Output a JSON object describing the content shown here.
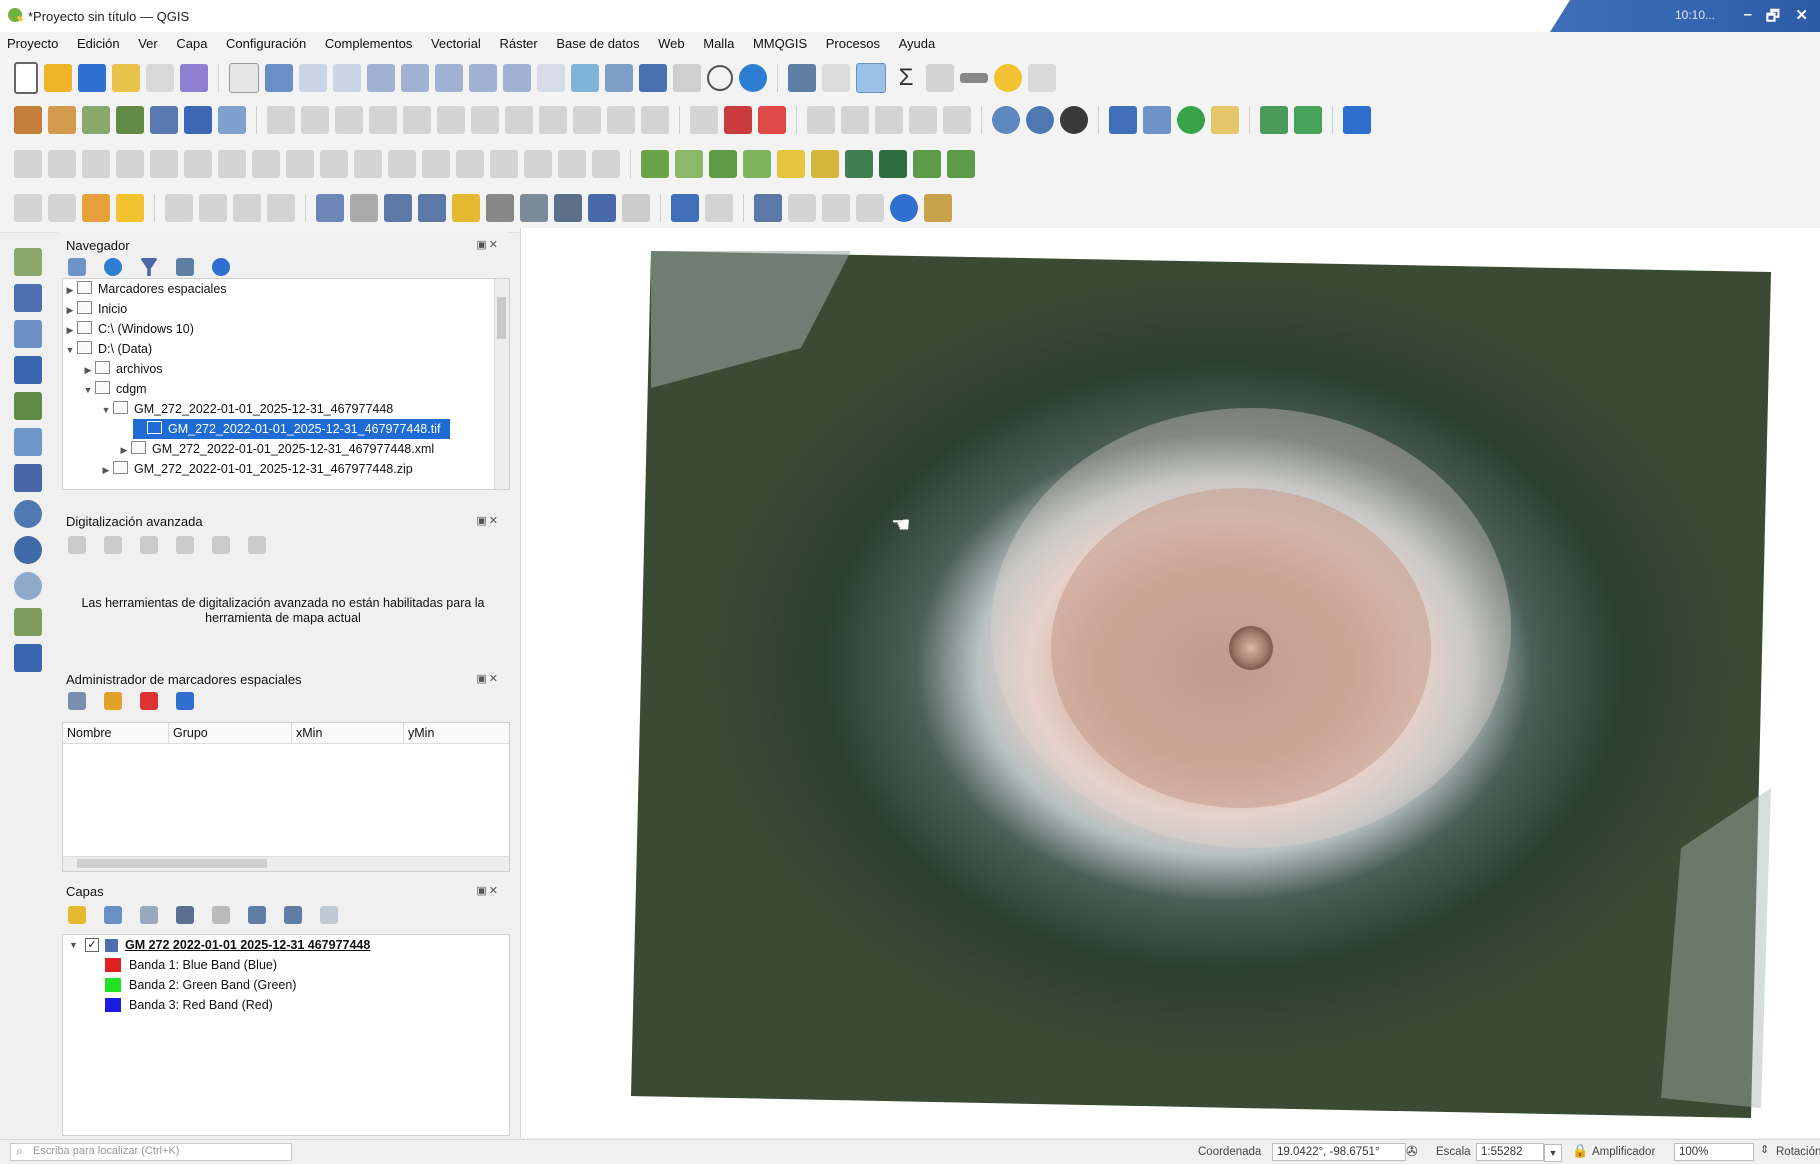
{
  "window": {
    "title": "*Proyecto sin título — QGIS",
    "clock": "10:10...",
    "controls": [
      "–",
      "🗗",
      "✕"
    ]
  },
  "menu": [
    "Proyecto",
    "Edición",
    "Ver",
    "Capa",
    "Configuración",
    "Complementos",
    "Vectorial",
    "Ráster",
    "Base de datos",
    "Web",
    "Malla",
    "MMQGIS",
    "Procesos",
    "Ayuda"
  ],
  "navigator": {
    "title": "Navegador",
    "items": [
      {
        "label": "Marcadores espaciales",
        "indent": 0
      },
      {
        "label": "Inicio",
        "indent": 0
      },
      {
        "label": "C:\\ (Windows 10)",
        "indent": 0
      },
      {
        "label": "D:\\ (Data)",
        "indent": 0
      },
      {
        "label": "archivos",
        "indent": 1
      },
      {
        "label": "cdgm",
        "indent": 1
      },
      {
        "label": "GM_272_2022-01-01_2025-12-31_467977448",
        "indent": 2
      },
      {
        "label": "GM_272_2022-01-01_2025-12-31_467977448.tif",
        "indent": 3,
        "selected": true
      },
      {
        "label": "GM_272_2022-01-01_2025-12-31_467977448.xml",
        "indent": 3
      },
      {
        "label": "GM_272_2022-01-01_2025-12-31_467977448.zip",
        "indent": 2
      }
    ]
  },
  "advanced_digitizing": {
    "title": "Digitalización avanzada",
    "message": "Las herramientas de digitalización avanzada no están habilitadas para la herramienta de mapa actual"
  },
  "bookmarks": {
    "title": "Administrador de marcadores espaciales",
    "columns": [
      "Nombre",
      "Grupo",
      "xMin",
      "yMin"
    ]
  },
  "layers": {
    "title": "Capas",
    "layer_name": "GM 272 2022-01-01 2025-12-31 467977448",
    "bands": [
      {
        "label": "Banda 1: Blue Band (Blue)",
        "color": "#e02020"
      },
      {
        "label": "Banda 2: Green Band (Green)",
        "color": "#22e022"
      },
      {
        "label": "Banda 3: Red Band (Red)",
        "color": "#1c1ce0"
      }
    ]
  },
  "status": {
    "search_placeholder": "Escriba para localizar (Ctrl+K)",
    "coord_label": "Coordenada",
    "coord_value": "19.0422°, -98.6751°",
    "scale_label": "Escala",
    "scale_value": "1:55282",
    "magnifier_label": "Amplificador",
    "magnifier_value": "100%",
    "rotation_label": "Rotación"
  }
}
